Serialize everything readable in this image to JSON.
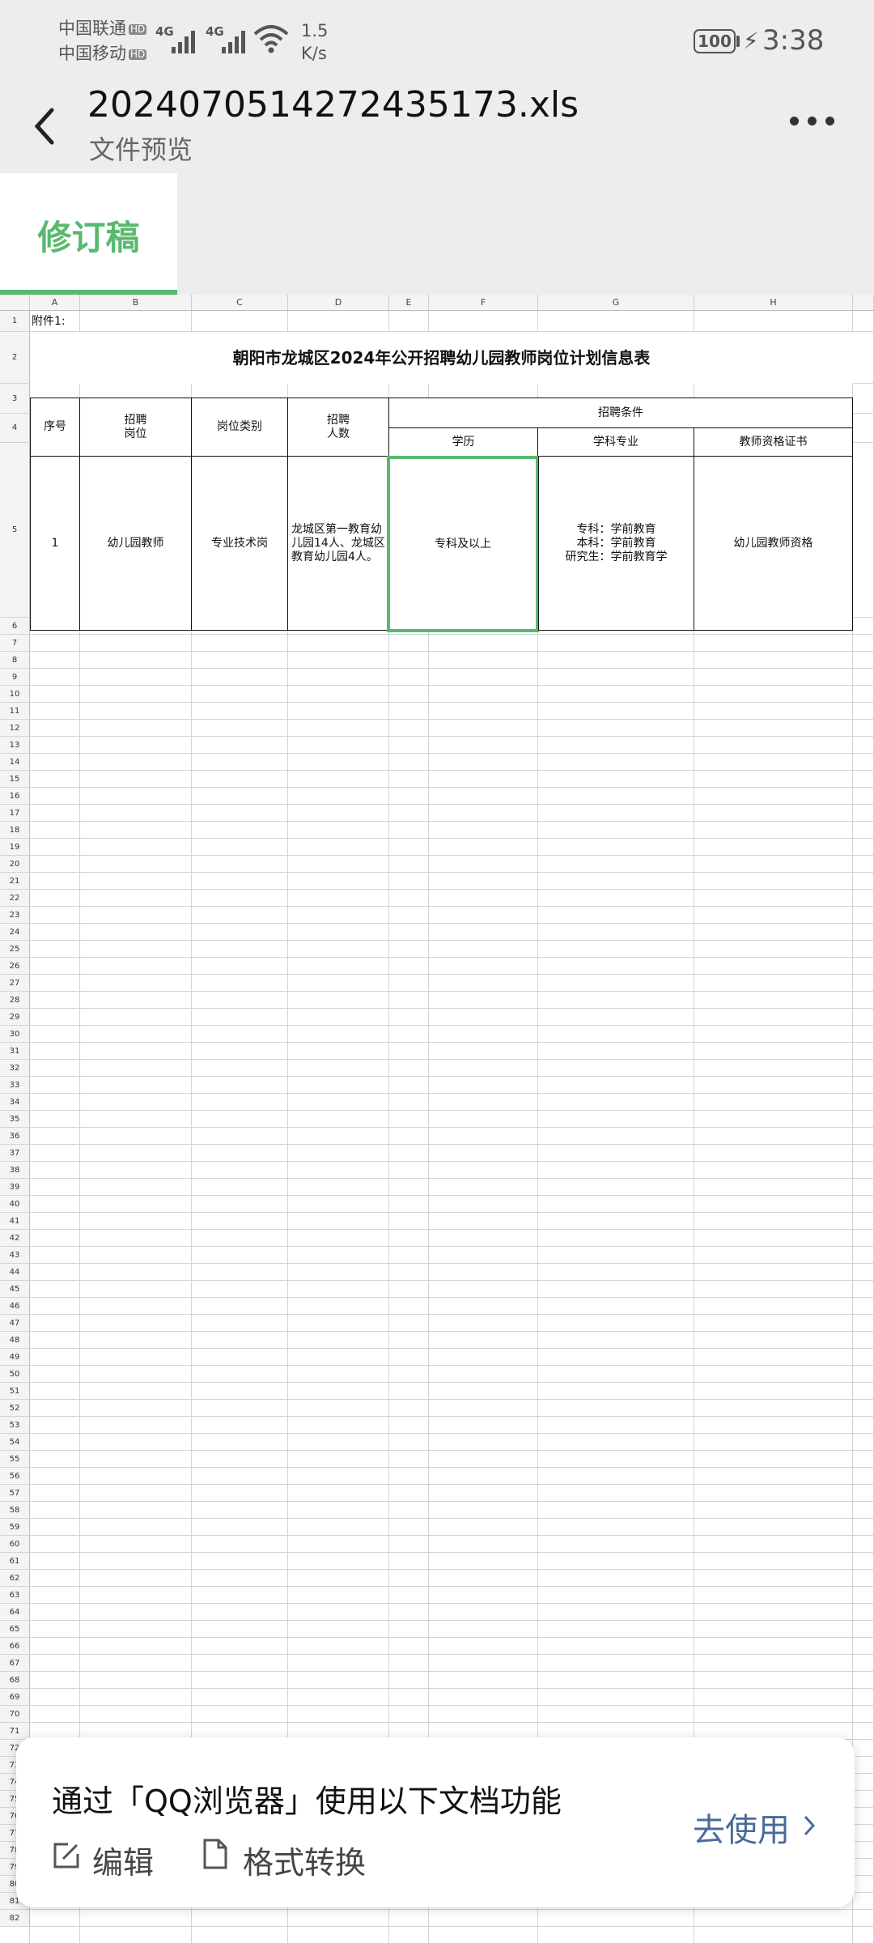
{
  "status_bar": {
    "carrier_1": "中国联通",
    "carrier_2": "中国移动",
    "hd_badge": "HD",
    "network": "4G",
    "speed_value": "1.5",
    "speed_unit": "K/s",
    "battery": "100",
    "time": "3:38"
  },
  "header": {
    "file_name": "20240705142724351​73.xls",
    "subtitle": "文件预览",
    "back_icon": "chevron-left-icon",
    "more_icon": "more-dots-icon"
  },
  "tabs": [
    {
      "label": "修订稿",
      "active": true
    }
  ],
  "sheet": {
    "columns": [
      "A",
      "B",
      "C",
      "D",
      "E",
      "F",
      "G",
      "H"
    ],
    "note": "附件1:",
    "title": "朝阳市龙城区2024年公开招聘幼儿园教师岗位计划信息表",
    "headers": {
      "seq": "序号",
      "position_line1": "招聘",
      "position_line2": "岗位",
      "category": "岗位类别",
      "count_line1": "招聘",
      "count_line2": "人数",
      "conditions": "招聘条件",
      "education": "学历",
      "major": "学科专业",
      "certificate": "教师资格证书"
    },
    "row": {
      "seq": "1",
      "position": "幼儿园教师",
      "category": "专业技术岗",
      "count_text": "龙城区第一教育幼儿园14人、龙城区教育幼儿园4人。",
      "education": "专科及以上",
      "major_1": "专科：学前教育",
      "major_2": "本科：学前教育",
      "major_3": "研究生：学前教育学",
      "certificate": "幼儿园教师资格"
    },
    "selected_cell": "F5",
    "row_count": 82
  },
  "banner": {
    "text": "通过「QQ浏览器」使用以下文档功能",
    "action_edit": "编辑",
    "action_convert": "格式转换",
    "go_label": "去使用"
  },
  "colors": {
    "accent_green": "#58b96f",
    "banner_link": "#4a6b9a",
    "header_bg": "#ededed"
  }
}
